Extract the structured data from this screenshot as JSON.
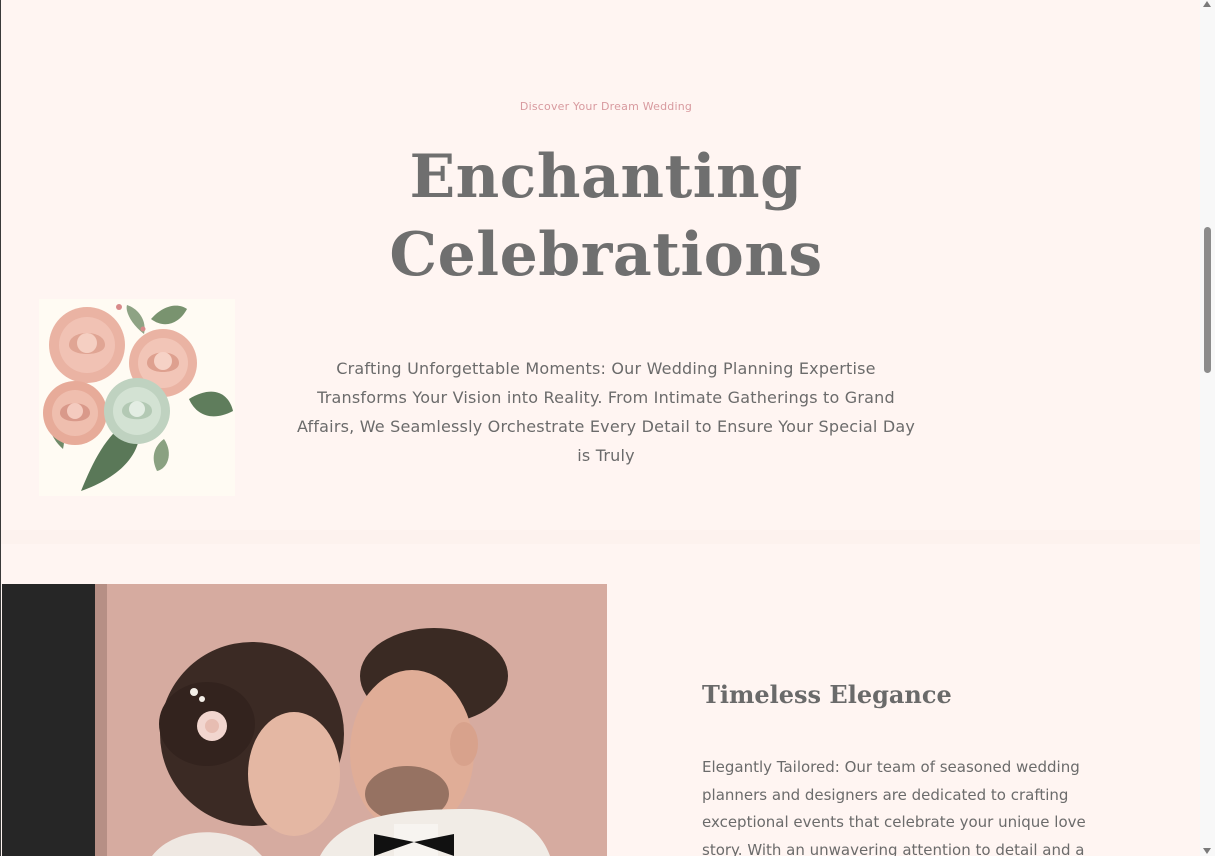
{
  "hero": {
    "eyebrow": "Discover Your Dream Wedding",
    "title_line1": "Enchanting",
    "title_line2": "Celebrations",
    "description": "Crafting Unforgettable Moments: Our Wedding Planning Expertise Transforms Your Vision into Reality. From Intimate Gatherings to Grand Affairs, We Seamlessly Orchestrate Every Detail to Ensure Your Special Day is Truly"
  },
  "feature": {
    "title": "Timeless Elegance",
    "text": "Elegantly Tailored: Our team of seasoned wedding planners and designers are dedicated to crafting exceptional events that celebrate your unique love story. With an unwavering attention to detail and a"
  },
  "images": {
    "flowers": "rose-bouquet-illustration",
    "couple": "bride-and-groom-photo"
  },
  "colors": {
    "background": "#fff5f2",
    "accent": "#d89a9f",
    "heading": "#6f6f6f",
    "body_text": "#6b6b6b"
  }
}
